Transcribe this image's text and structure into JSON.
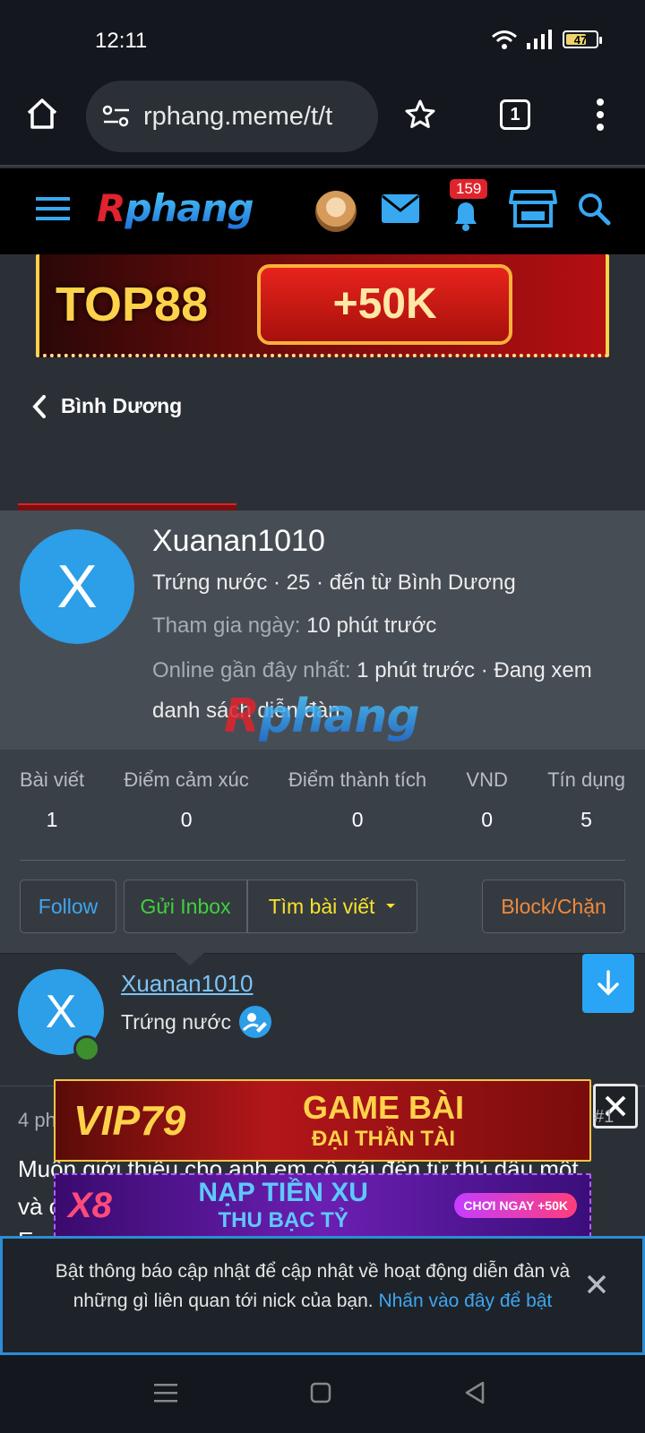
{
  "status_bar": {
    "time": "12:11",
    "battery": "47",
    "icons": [
      "wifi-icon",
      "signal-icon",
      "battery-icon"
    ]
  },
  "browser": {
    "url": "rphang.meme/t/t",
    "tab_count": "1",
    "icons": [
      "home-icon",
      "site-settings-icon",
      "star-icon",
      "tabs-icon",
      "more-icon"
    ]
  },
  "site_header": {
    "logo_r": "R",
    "logo_rest": "phang",
    "notification_count": "159",
    "icons": [
      "menu-icon",
      "avatar",
      "mail-icon",
      "bell-icon",
      "shop-icon",
      "search-icon"
    ]
  },
  "ads": {
    "top": {
      "brand": "TOP88",
      "offer": "+50K"
    },
    "vip": {
      "brand": "VIP79",
      "line1": "GAME BÀI",
      "line2": "ĐẠI THẦN TÀI"
    },
    "x8": {
      "brand": "X8",
      "line1": "NẠP TIỀN XU",
      "line2": "THU BẠC TỶ",
      "cta": "CHƠI NGAY +50K"
    }
  },
  "breadcrumb": {
    "label": "Bình Dương"
  },
  "profile": {
    "initial": "X",
    "username": "Xuanan1010",
    "subtitle": "Trứng nước · 25 · đến từ Bình Dương",
    "joined_label": "Tham gia ngày:",
    "joined_value": "10 phút trước",
    "online_label": "Online gần đây nhất:",
    "online_value": "1 phút trước · Đang xem",
    "online_value2": "danh sách diễn đàn",
    "watermark_r": "R",
    "watermark_rest": "phang",
    "stats": [
      {
        "label": "Bài viết",
        "value": "1"
      },
      {
        "label": "Điểm cảm xúc",
        "value": "0"
      },
      {
        "label": "Điểm thành tích",
        "value": "0"
      },
      {
        "label": "VND",
        "value": "0"
      },
      {
        "label": "Tín dụng",
        "value": "5"
      }
    ],
    "buttons": {
      "follow": "Follow",
      "inbox": "Gửi Inbox",
      "find_posts": "Tìm bài viết",
      "block": "Block/Chặn"
    },
    "colors": {
      "follow": "#3ea6f0",
      "inbox": "#3fd23a",
      "find_posts": "#f7e22a",
      "block": "#f08a3c"
    }
  },
  "post": {
    "initial": "X",
    "username": "Xuanan1010",
    "rank": "Trứng nước",
    "time_partial": "4 ph",
    "post_number": "#1",
    "body_line1": "Muốn giới thiệu cho anh em cô gái đến từ thủ dầu một",
    "body_line2": "và c",
    "body_line3": "Em"
  },
  "notification": {
    "text": "Bật thông báo cập nhật để cập nhật về hoạt động diễn đàn và những gì liên quan tới nick của bạn.",
    "link": "Nhấn vào đây để bật"
  }
}
